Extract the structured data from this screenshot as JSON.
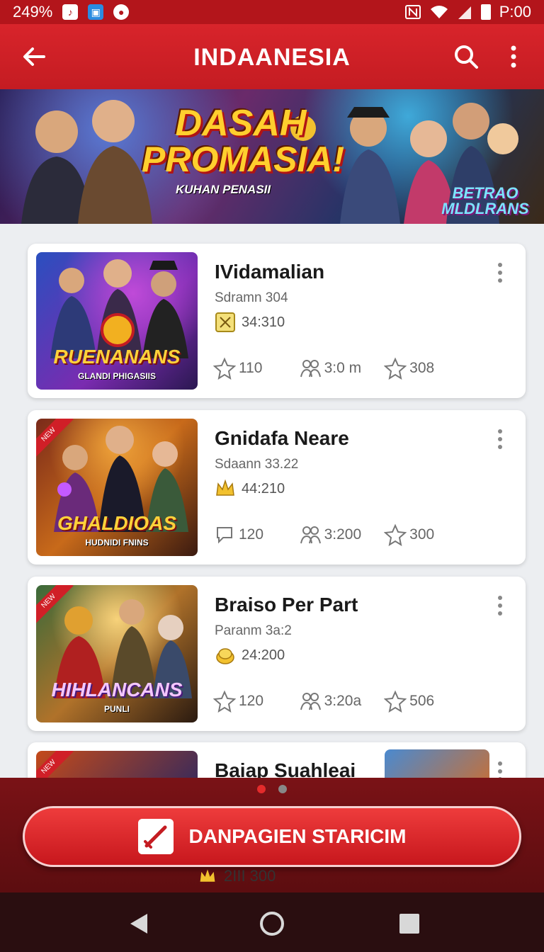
{
  "status_bar": {
    "left_text": "249%",
    "time": "P:00",
    "icons": [
      "tiktok-icon",
      "app-icon",
      "notification-icon",
      "nfc-icon",
      "wifi-icon",
      "signal-icon",
      "battery-icon"
    ]
  },
  "app_bar": {
    "title": "INDAANESIA",
    "icons": [
      "back-arrow-icon",
      "search-icon",
      "more-vert-icon"
    ]
  },
  "banner": {
    "title_line1": "DASAH",
    "title_line2": "PROMASIA!",
    "subtitle": "KUHAN PENASII",
    "badge": "BETRAO MLDLRANS"
  },
  "cards": [
    {
      "title": "IVidamalian",
      "subtitle": "Sdramn 304",
      "meta": "34:310",
      "thumb_title": "RUENANANS",
      "thumb_sub": "GLANDI PHIGASIIS",
      "stats": [
        "110",
        "3:0 m",
        "308"
      ]
    },
    {
      "title": "Gnidafa Neare",
      "subtitle": "Sdaann 33.22",
      "meta": "44:210",
      "thumb_title": "GHALDIOAS",
      "thumb_sub": "HUDNIDI FNINS",
      "ribbon": "NEW",
      "stats": [
        "120",
        "3:200",
        "300"
      ]
    },
    {
      "title": "Braiso Per Part",
      "subtitle": "Paranm 3a:2",
      "meta": "24:200",
      "thumb_title": "HIHLANCANS",
      "thumb_sub": "PUNLI",
      "ribbon": "NEW",
      "stats": [
        "120",
        "3:20a",
        "506"
      ]
    },
    {
      "title": "Baiap Suahleai",
      "ribbon": "NEW"
    }
  ],
  "pager": {
    "count": 2,
    "active": 0
  },
  "cta": {
    "label": "DANPAGIEN STARICIM"
  },
  "peek_meta": "2III 300",
  "colors": {
    "primary": "#d01f27",
    "primary_dark": "#b3151b",
    "background": "#eceef1",
    "card": "#ffffff"
  }
}
